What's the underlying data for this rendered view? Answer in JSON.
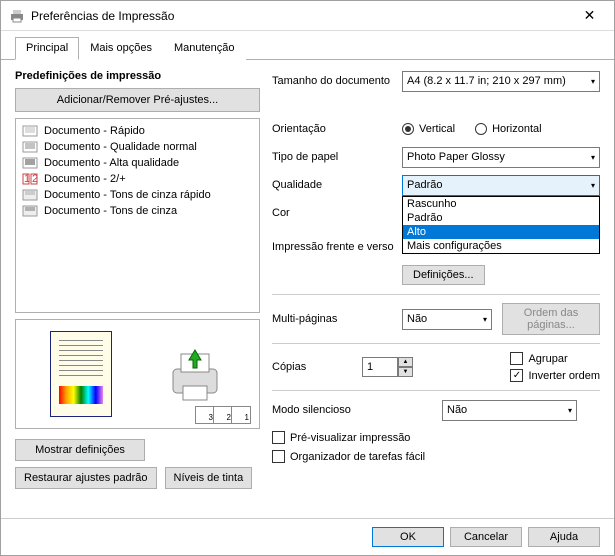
{
  "window": {
    "title": "Preferências de Impressão"
  },
  "tabs": {
    "principal": "Principal",
    "mais": "Mais opções",
    "manut": "Manutenção"
  },
  "presets": {
    "heading": "Predefinições de impressão",
    "add_remove": "Adicionar/Remover Pré-ajustes...",
    "items": [
      "Documento - Rápido",
      "Documento - Qualidade normal",
      "Documento - Alta qualidade",
      "Documento - 2/+",
      "Documento - Tons de cinza rápido",
      "Documento - Tons de cinza"
    ]
  },
  "leftButtons": {
    "show": "Mostrar definições",
    "restore": "Restaurar ajustes padrão",
    "ink": "Níveis de tinta"
  },
  "right": {
    "docsize_label": "Tamanho do documento",
    "docsize_value": "A4 (8.2 x 11.7 in; 210 x 297 mm)",
    "orient_label": "Orientação",
    "orient_v": "Vertical",
    "orient_h": "Horizontal",
    "paper_label": "Tipo de papel",
    "paper_value": "Photo Paper Glossy",
    "quality_label": "Qualidade",
    "quality_value": "Padrão",
    "quality_options": {
      "o0": "Rascunho",
      "o1": "Padrão",
      "o2": "Alto",
      "o3": "Mais configurações"
    },
    "color_label": "Cor",
    "duplex_label": "Impressão frente e verso",
    "settings_btn": "Definições...",
    "multi_label": "Multi-páginas",
    "multi_value": "Não",
    "page_order": "Ordem das páginas...",
    "copies_label": "Cópias",
    "copies_value": "1",
    "collate": "Agrupar",
    "reverse": "Inverter ordem",
    "quiet_label": "Modo silencioso",
    "quiet_value": "Não",
    "preview_chk": "Pré-visualizar impressão",
    "organizer_chk": "Organizador de tarefas fácil"
  },
  "footer": {
    "ok": "OK",
    "cancel": "Cancelar",
    "help": "Ajuda"
  }
}
